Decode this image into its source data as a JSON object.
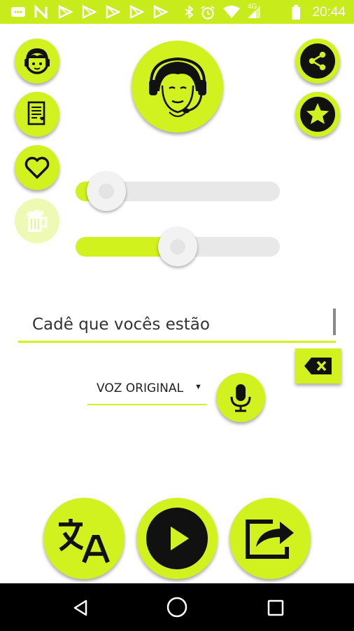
{
  "status_bar": {
    "time": "20:44",
    "network": "4G",
    "icons": [
      "message-icon",
      "n-notification-icon",
      "play-store-icon",
      "play-store-icon",
      "play-store-icon",
      "play-store-icon",
      "play-store-icon",
      "bluetooth-icon",
      "alarm-icon",
      "wifi-icon",
      "signal-icon",
      "battery-icon"
    ]
  },
  "side_buttons": [
    "avatar-icon",
    "notes-icon",
    "heart-icon",
    "beer-icon"
  ],
  "top_right_buttons": [
    "share-icon",
    "star-icon"
  ],
  "main_avatar": "headset-avatar-icon",
  "sliders": [
    {
      "name": "slider-1",
      "value": 0.15
    },
    {
      "name": "slider-2",
      "value": 0.5
    }
  ],
  "text_input": {
    "value": "Cadê que vocês estão"
  },
  "voice_select": {
    "value": "VOZ ORIGINAL"
  },
  "bottom_buttons": [
    "translate-icon",
    "play-icon",
    "share-out-icon"
  ],
  "nav_bar": [
    "back-icon",
    "home-icon",
    "recents-icon"
  ],
  "colors": {
    "accent": "#d2f21f",
    "status_bar": "#c8ec1b",
    "nav_bar": "#000000"
  }
}
